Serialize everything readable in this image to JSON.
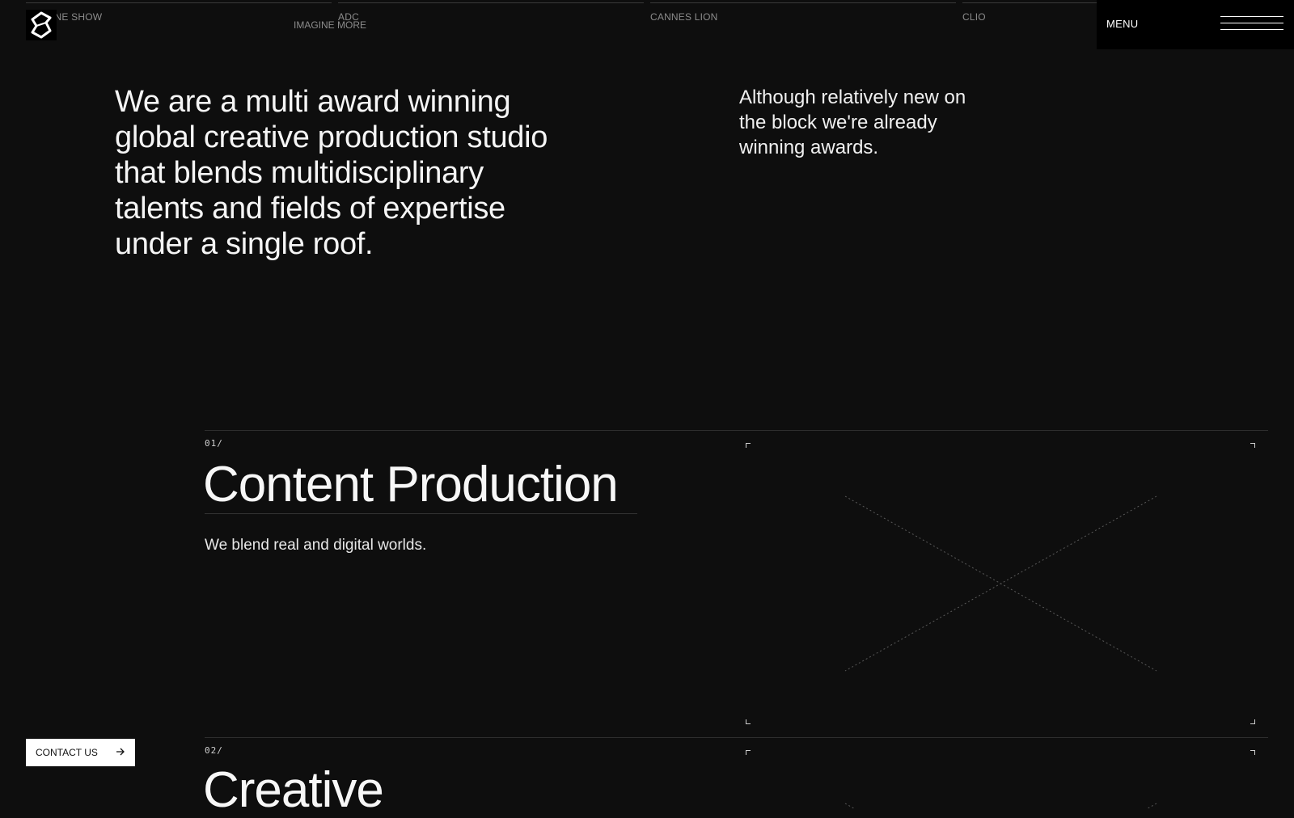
{
  "awards": [
    {
      "label": "ONE SHOW"
    },
    {
      "label": "ADC"
    },
    {
      "label": "CANNES LION"
    },
    {
      "label": "CLIO"
    }
  ],
  "imagine_more": "IMAGINE MORE",
  "menu": {
    "label": "MENU",
    "icon": "hamburger-icon"
  },
  "logo": {
    "icon": "studio-logo"
  },
  "hero": {
    "headline": "We are a multi award winning global creative production studio that blends multidisciplinary talents and fields of expertise under a single roof.",
    "side": "Although relatively new on the block we're already winning awards."
  },
  "sections": [
    {
      "number": "01/",
      "title": "Content Production",
      "description": "We blend real and digital worlds."
    },
    {
      "number": "02/",
      "title": "Creative",
      "description": ""
    }
  ],
  "contact": {
    "label": "CONTACT US",
    "icon": "arrow-right-icon"
  },
  "colors": {
    "background": "#0e0e0e",
    "text": "#f2f2f2",
    "muted": "#8c8c8c",
    "menu_bg": "#000000",
    "button_bg": "#ffffff"
  }
}
